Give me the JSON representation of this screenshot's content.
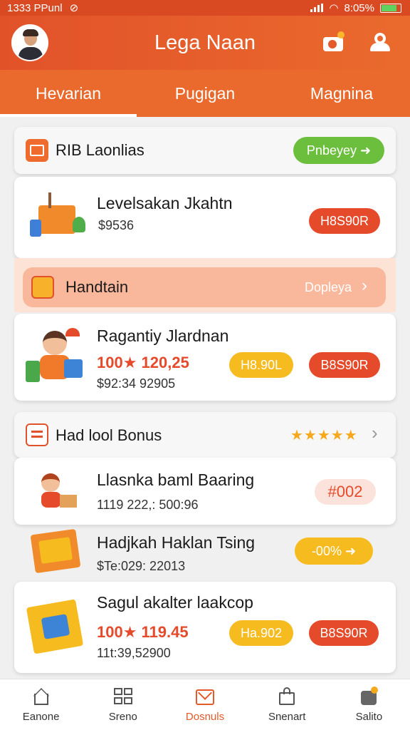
{
  "status": {
    "time": "1333 PPunl",
    "battery": "8:05%"
  },
  "appbar": {
    "title": "Lega Naan"
  },
  "tabs": [
    "Hevarian",
    "Pugigan",
    "Magnina"
  ],
  "sections": {
    "top_header": {
      "label": "RIB Laonlias",
      "action": "Pnbeyey ➜"
    },
    "item1": {
      "name": "Levelsakan Jkahtn",
      "price": "$9536",
      "button": "H8S90R"
    },
    "band": {
      "label": "Handtain",
      "action": "Dopleya"
    },
    "item2": {
      "name": "Ragantiy Jlardnan",
      "promo": "100★ 120,25",
      "sub": "$92:34 92905",
      "button_yellow": "H8.90L",
      "button_red": "B8S90R"
    },
    "bonus_header": {
      "label": "Had lool Bonus",
      "stars": "★★★★★"
    },
    "item3": {
      "name": "Llasnka baml Baaring",
      "sub": "1119 222,: 500:96",
      "badge": "#002"
    },
    "item4": {
      "name": "Hadjkah Haklan Tsing",
      "sub": "$Te:029: 22013",
      "button": "-00% ➜"
    },
    "item5": {
      "name": "Sagul akalter laakcop",
      "promo": "100★ 119.45",
      "sub": "11t:39,52900",
      "button_yellow": "Ha.902",
      "button_red": "B8S90R"
    }
  },
  "bottom_nav": [
    "Eanone",
    "Sreno",
    "Dosnuls",
    "Snenart",
    "Salito"
  ],
  "colors": {
    "accent": "#e54a2b",
    "yellow": "#f6bb1f",
    "green": "#6cbf3c",
    "appbar": "#e2522a"
  }
}
